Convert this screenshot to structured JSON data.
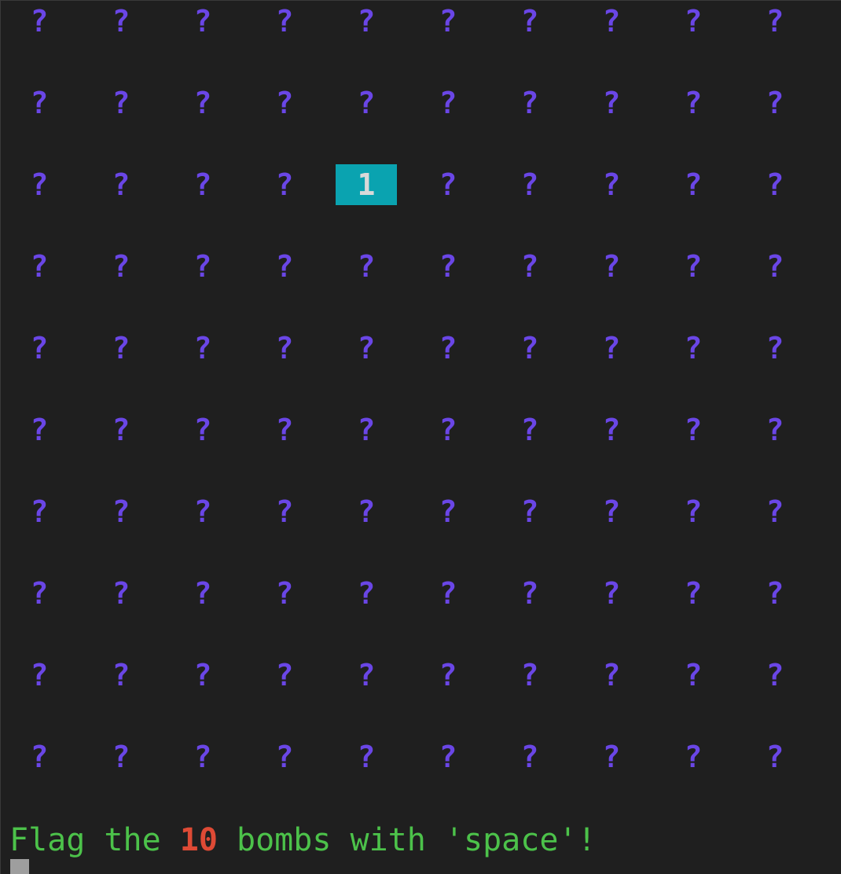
{
  "board": {
    "rows": 10,
    "cols": 10,
    "hidden_symbol": "?",
    "revealed": [
      {
        "row": 2,
        "col": 4,
        "value": "1"
      }
    ]
  },
  "status": {
    "prefix": "Flag the ",
    "bomb_count": "10",
    "suffix": " bombs with 'space'!"
  },
  "colors": {
    "background": "#1f1f1f",
    "hidden": "#6a46e6",
    "revealed_bg": "#0aa3b0",
    "revealed_text": "#d9d9d9",
    "status_text": "#4cc24a",
    "bomb_count": "#de4a35"
  }
}
